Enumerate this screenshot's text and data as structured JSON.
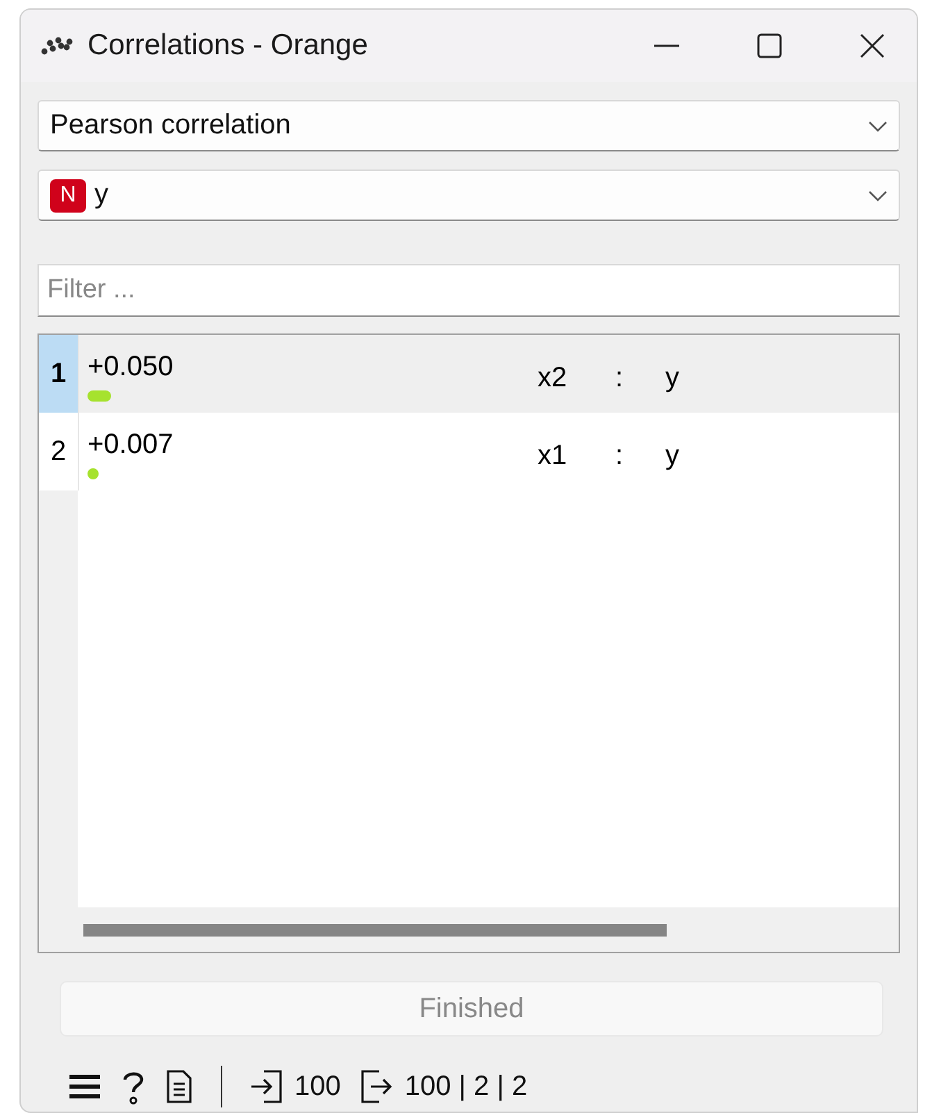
{
  "window": {
    "title": "Correlations - Orange"
  },
  "correlation_type": {
    "value": "Pearson correlation"
  },
  "feature": {
    "badge": "N",
    "value": "y"
  },
  "filter": {
    "placeholder": "Filter ..."
  },
  "table": {
    "rows": [
      {
        "index": "1",
        "selected": true,
        "value": "+0.050",
        "level": 0.05,
        "attr1": "x2",
        "separator": ":",
        "attr2": "y"
      },
      {
        "index": "2",
        "selected": false,
        "value": "+0.007",
        "level": 0.007,
        "attr1": "x1",
        "separator": ":",
        "attr2": "y"
      }
    ]
  },
  "status": {
    "label": "Finished"
  },
  "status_bar": {
    "input_count": "100",
    "output_summary": "100 | 2 | 2"
  }
}
